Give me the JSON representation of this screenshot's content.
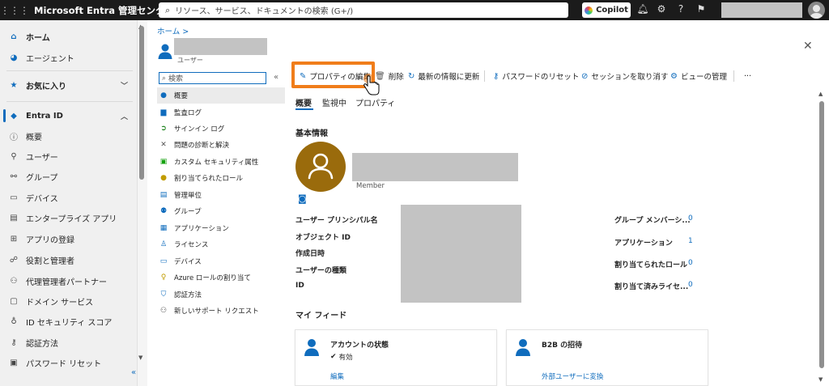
{
  "topbar": {
    "title": "Microsoft Entra 管理センター",
    "search_placeholder": "リソース、サービス、ドキュメントの検索 (G+/)",
    "copilot_label": "Copilot"
  },
  "leftnav": {
    "home": "ホーム",
    "agent": "エージェント",
    "favorites": "お気に入り",
    "entra_id": "Entra ID",
    "items": [
      "概要",
      "ユーザー",
      "グループ",
      "デバイス",
      "エンタープライズ アプリ",
      "アプリの登録",
      "役割と管理者",
      "代理管理者パートナー",
      "ドメイン サービス",
      "ID セキュリティ スコア",
      "認証方法",
      "パスワード リセット"
    ],
    "collapse": "«"
  },
  "main": {
    "breadcrumb": "ホーム >",
    "user_type": "ユーザー",
    "close": "✕"
  },
  "resource_menu": {
    "search_placeholder": "検索",
    "collapse": "«",
    "items": [
      "概要",
      "監査ログ",
      "サインイン ログ",
      "問題の診断と解決",
      "カスタム セキュリティ属性",
      "割り当てられたロール",
      "管理単位",
      "グループ",
      "アプリケーション",
      "ライセンス",
      "デバイス",
      "Azure ロールの割り当て",
      "認証方法",
      "新しいサポート リクエスト"
    ]
  },
  "toolbar": {
    "edit": "プロパティの編集",
    "delete": "削除",
    "refresh": "最新の情報に更新",
    "reset_password": "パスワードのリセット",
    "revoke_sessions": "セッションを取り消す",
    "manage_view": "ビューの管理",
    "more": "···"
  },
  "tabs": [
    "概要",
    "監視中",
    "プロパティ"
  ],
  "basic_info": {
    "title": "基本情報",
    "member": "Member",
    "fields": [
      "ユーザー プリンシパル名",
      "オブジェクト ID",
      "作成日時",
      "ユーザーの種類",
      "ID"
    ],
    "stats": [
      {
        "label": "グループ メンバーシ...",
        "value": "0"
      },
      {
        "label": "アプリケーション",
        "value": "1"
      },
      {
        "label": "割り当てられたロール",
        "value": "0"
      },
      {
        "label": "割り当て済みライセ...",
        "value": "0"
      }
    ]
  },
  "my_feed": {
    "title": "マイ フィード",
    "account_card": {
      "title": "アカウントの状態",
      "status": "有効",
      "link": "編集"
    },
    "b2b_card": {
      "title": "B2B の招待",
      "link": "外部ユーザーに変換"
    }
  },
  "colors": {
    "accent": "#0f6cbd",
    "highlight": "#f07d1a",
    "avatar": "#9a6b0c"
  }
}
